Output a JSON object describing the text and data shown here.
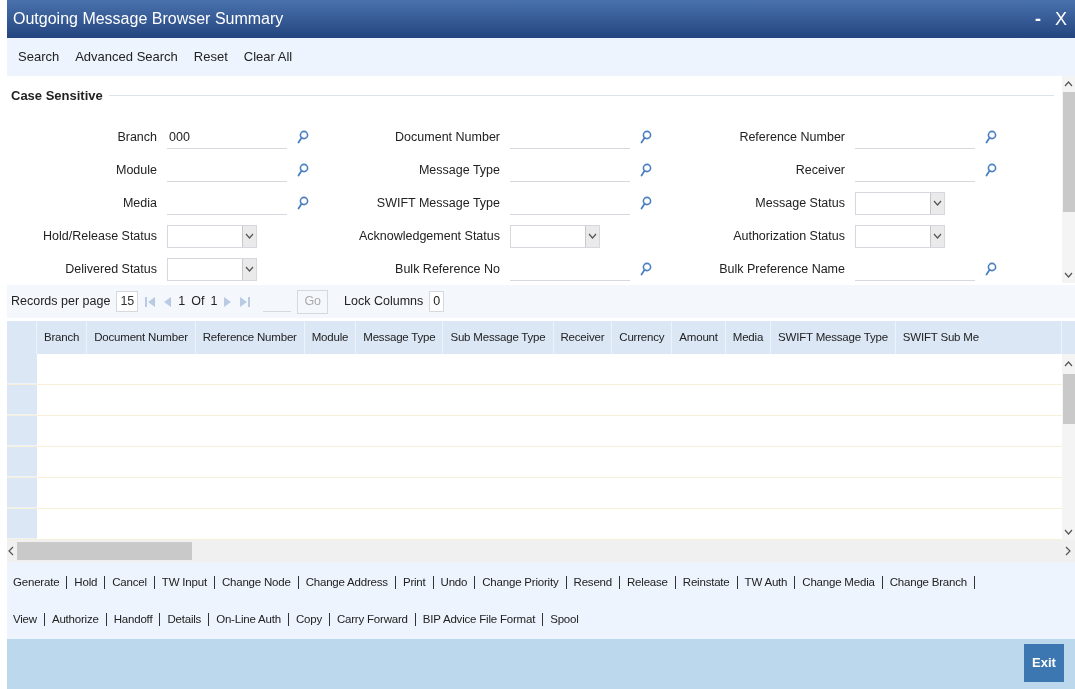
{
  "window": {
    "title": "Outgoing Message Browser Summary",
    "minimize": "-",
    "close": "X"
  },
  "toolbar": [
    "Search",
    "Advanced Search",
    "Reset",
    "Clear All"
  ],
  "form": {
    "legend": "Case Sensitive",
    "columns": [
      [
        {
          "label": "Branch",
          "kind": "lookup",
          "value": "000"
        },
        {
          "label": "Module",
          "kind": "lookup"
        },
        {
          "label": "Media",
          "kind": "lookup"
        },
        {
          "label": "Hold/Release Status",
          "kind": "select"
        },
        {
          "label": "Delivered Status",
          "kind": "select"
        }
      ],
      [
        {
          "label": "Document Number",
          "kind": "lookup"
        },
        {
          "label": "Message Type",
          "kind": "lookup"
        },
        {
          "label": "SWIFT Message Type",
          "kind": "lookup"
        },
        {
          "label": "Acknowledgement Status",
          "kind": "select"
        },
        {
          "label": "Bulk Reference No",
          "kind": "lookup"
        }
      ],
      [
        {
          "label": "Reference Number",
          "kind": "lookup"
        },
        {
          "label": "Receiver",
          "kind": "lookup"
        },
        {
          "label": "Message Status",
          "kind": "select"
        },
        {
          "label": "Authorization Status",
          "kind": "select"
        },
        {
          "label": "Bulk Preference Name",
          "kind": "lookup"
        }
      ]
    ]
  },
  "pagination": {
    "records_label": "Records per page",
    "records_per_page": "15",
    "page": "1",
    "of": "Of",
    "total": "1",
    "go": "Go",
    "lock_label": "Lock Columns",
    "lock_value": "0"
  },
  "table": {
    "columns": [
      "Branch",
      "Document Number",
      "Reference Number",
      "Module",
      "Message Type",
      "Sub Message Type",
      "Receiver",
      "Currency",
      "Amount",
      "Media",
      "SWIFT Message Type",
      "SWIFT Sub Me"
    ]
  },
  "actions": [
    [
      "Generate",
      "Hold",
      "Cancel",
      "TW Input",
      "Change Node",
      "Change Address",
      "Print",
      "Undo",
      "Change Priority",
      "Resend",
      "Release",
      "Reinstate",
      "TW Auth",
      "Change Media",
      "Change Branch"
    ],
    [
      "View",
      "Authorize",
      "Handoff",
      "Details",
      "On-Line Auth",
      "Copy",
      "Carry Forward",
      "BIP Advice File Format",
      "Spool"
    ]
  ],
  "footer": {
    "exit": "Exit"
  }
}
